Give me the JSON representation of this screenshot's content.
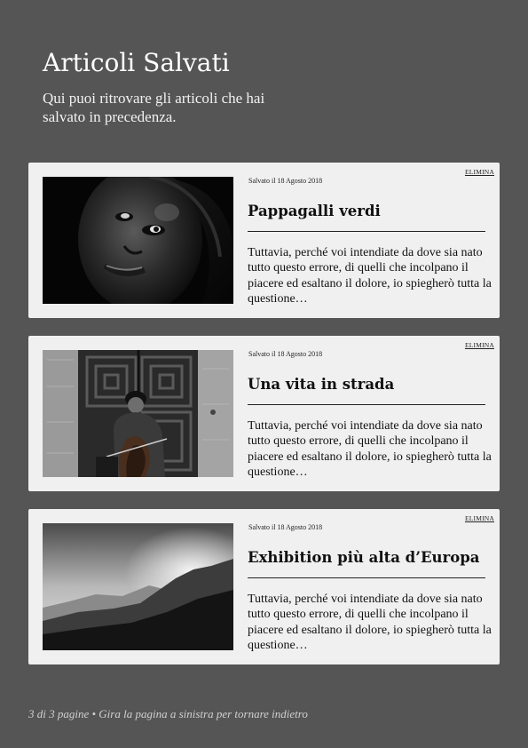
{
  "header": {
    "title": "Articoli Salvati",
    "subtitle": "Qui puoi ritrovare gli articoli che hai salvato in precedenza."
  },
  "articles": [
    {
      "saved_label": "Salvato il 18 Agosto 2018",
      "title": "Pappagalli verdi",
      "excerpt": "Tuttavia, perché voi intendiate da dove sia nato tutto questo errore, di quelli che incolpano il piacere ed esaltano il dolore, io spiegherò tutta la questione…",
      "delete_label": "ELIMINA",
      "image": "black-and-white-portrait-photo"
    },
    {
      "saved_label": "Salvato il 18 Agosto 2018",
      "title": "Una vita in strada",
      "excerpt": "Tuttavia, perché voi intendiate da dove sia nato tutto questo errore, di quelli che incolpano il piacere ed esaltano il dolore, io spiegherò tutta la questione…",
      "delete_label": "ELIMINA",
      "image": "street-cellist-photo"
    },
    {
      "saved_label": "Salvato il 18 Agosto 2018",
      "title": "Exhibition più alta d’Europa",
      "excerpt": "Tuttavia, perché voi intendiate da dove sia nato tutto questo errore, di quelli che incolpano il piacere ed esaltano il dolore, io spiegherò tutta la questione…",
      "delete_label": "ELIMINA",
      "image": "mountain-sunset-photo"
    }
  ],
  "footer": {
    "text": "3 di 3 pagine • Gira la pagina a sinistra per tornare indietro"
  },
  "colors": {
    "background": "#555555",
    "card": "#f0f0f0",
    "text": "#111111"
  }
}
